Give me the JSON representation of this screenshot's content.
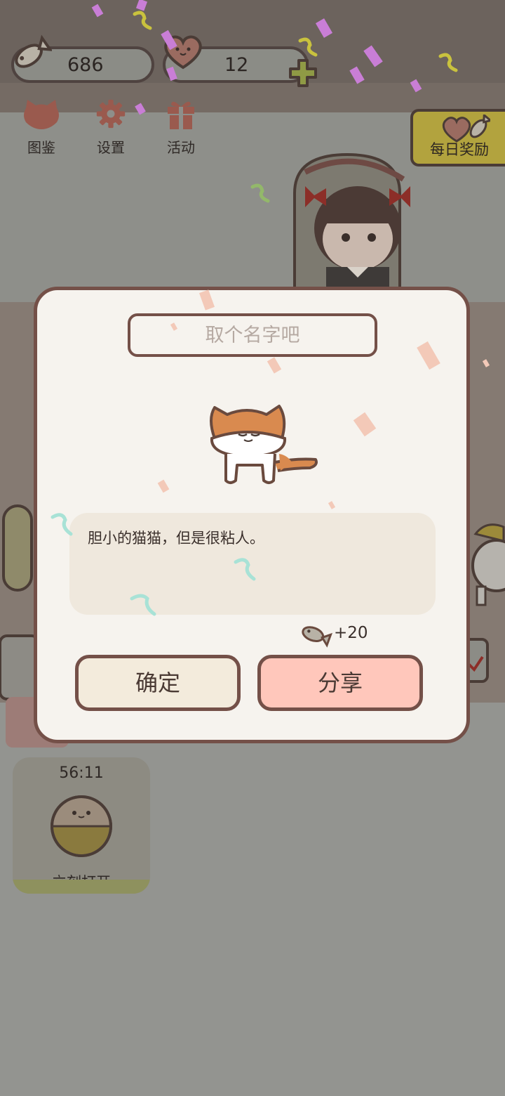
{
  "hud": {
    "fish_count": "686",
    "heart_count": "12"
  },
  "menu": {
    "collection_label": "图鉴",
    "settings_label": "设置",
    "events_label": "活动"
  },
  "daily_reward": {
    "label": "每日奖励"
  },
  "dialog": {
    "name_placeholder": "取个名字吧",
    "description": "胆小的猫猫，但是很粘人。",
    "reward_text": "+20",
    "confirm_label": "确定",
    "share_label": "分享"
  },
  "timer_card": {
    "time": "56:11",
    "open_label": "立刻打开"
  },
  "colors": {
    "dialog_bg": "#f6f3ee",
    "dialog_border": "#745048",
    "confirm_bg": "#f3ebdc",
    "share_bg": "#ffc7bb",
    "daily_flag": "#b2a33e"
  },
  "icons": [
    "fish-icon",
    "heart-icon",
    "plus-icon",
    "cat-face-icon",
    "gear-icon",
    "gift-icon",
    "fish-heart-icon",
    "cat-illustration",
    "egg-icon"
  ]
}
